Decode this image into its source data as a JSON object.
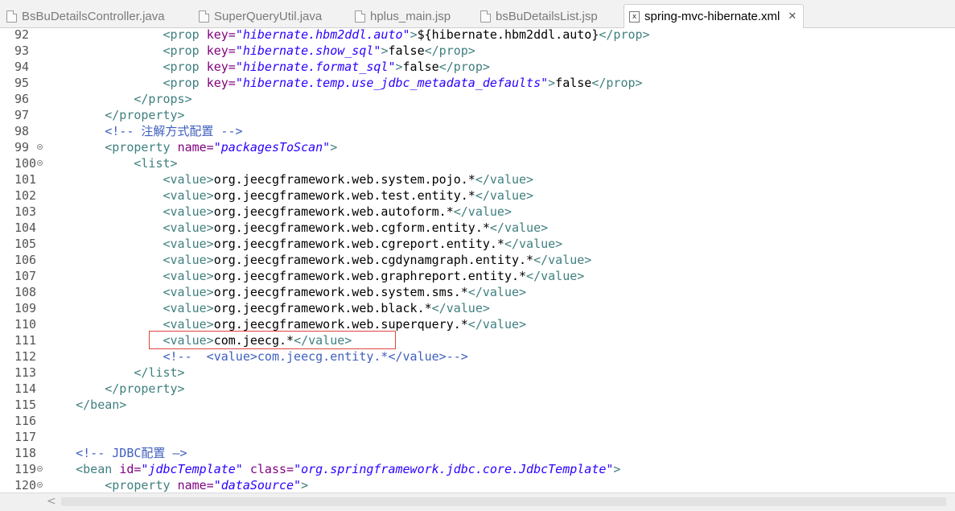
{
  "tabs": [
    {
      "label": "BsBuDetailsController.java",
      "active": false
    },
    {
      "label": "SuperQueryUtil.java",
      "active": false
    },
    {
      "label": "hplus_main.jsp",
      "active": false
    },
    {
      "label": "bsBuDetailsList.jsp",
      "active": false
    },
    {
      "label": "spring-mvc-hibernate.xml",
      "active": true
    }
  ],
  "active_tab_icon": "xml-file-icon",
  "close_glyph": "✕",
  "colors": {
    "tag": "#3f7f7f",
    "attribute": "#7f007f",
    "attribute_value": "#2a00ff",
    "comment": "#3f5fbf",
    "highlight_box": "#e0443e"
  },
  "lines": [
    {
      "n": "92",
      "fold": false,
      "tokens": [
        [
          "x",
          "                "
        ],
        [
          "t",
          "<prop "
        ],
        [
          "a",
          "key="
        ],
        [
          "v",
          "\"hibernate.hbm2ddl.auto\""
        ],
        [
          "t",
          ">"
        ],
        [
          "x",
          "${hibernate.hbm2ddl.auto}"
        ],
        [
          "t",
          "</prop>"
        ]
      ]
    },
    {
      "n": "93",
      "fold": false,
      "tokens": [
        [
          "x",
          "                "
        ],
        [
          "t",
          "<prop "
        ],
        [
          "a",
          "key="
        ],
        [
          "v",
          "\"hibernate.show_sql\""
        ],
        [
          "t",
          ">"
        ],
        [
          "x",
          "false"
        ],
        [
          "t",
          "</prop>"
        ]
      ]
    },
    {
      "n": "94",
      "fold": false,
      "tokens": [
        [
          "x",
          "                "
        ],
        [
          "t",
          "<prop "
        ],
        [
          "a",
          "key="
        ],
        [
          "v",
          "\"hibernate.format_sql\""
        ],
        [
          "t",
          ">"
        ],
        [
          "x",
          "false"
        ],
        [
          "t",
          "</prop>"
        ]
      ]
    },
    {
      "n": "95",
      "fold": false,
      "tokens": [
        [
          "x",
          "                "
        ],
        [
          "t",
          "<prop "
        ],
        [
          "a",
          "key="
        ],
        [
          "v",
          "\"hibernate.temp.use_jdbc_metadata_defaults\""
        ],
        [
          "t",
          ">"
        ],
        [
          "x",
          "false"
        ],
        [
          "t",
          "</prop>"
        ]
      ]
    },
    {
      "n": "96",
      "fold": false,
      "tokens": [
        [
          "x",
          "            "
        ],
        [
          "t",
          "</props>"
        ]
      ]
    },
    {
      "n": "97",
      "fold": false,
      "tokens": [
        [
          "x",
          "        "
        ],
        [
          "t",
          "</property>"
        ]
      ]
    },
    {
      "n": "98",
      "fold": false,
      "tokens": [
        [
          "x",
          "        "
        ],
        [
          "c",
          "<!-- 注解方式配置 -->"
        ]
      ]
    },
    {
      "n": "99",
      "fold": true,
      "tokens": [
        [
          "x",
          "        "
        ],
        [
          "t",
          "<property "
        ],
        [
          "a",
          "name="
        ],
        [
          "v",
          "\"packagesToScan\""
        ],
        [
          "t",
          ">"
        ]
      ]
    },
    {
      "n": "100",
      "fold": true,
      "tokens": [
        [
          "x",
          "            "
        ],
        [
          "t",
          "<list>"
        ]
      ]
    },
    {
      "n": "101",
      "fold": false,
      "tokens": [
        [
          "x",
          "                "
        ],
        [
          "t",
          "<value>"
        ],
        [
          "x",
          "org.jeecgframework.web.system.pojo.*"
        ],
        [
          "t",
          "</value>"
        ]
      ]
    },
    {
      "n": "102",
      "fold": false,
      "tokens": [
        [
          "x",
          "                "
        ],
        [
          "t",
          "<value>"
        ],
        [
          "x",
          "org.jeecgframework.web.test.entity.*"
        ],
        [
          "t",
          "</value>"
        ]
      ]
    },
    {
      "n": "103",
      "fold": false,
      "tokens": [
        [
          "x",
          "                "
        ],
        [
          "t",
          "<value>"
        ],
        [
          "x",
          "org.jeecgframework.web.autoform.*"
        ],
        [
          "t",
          "</value>"
        ]
      ]
    },
    {
      "n": "104",
      "fold": false,
      "tokens": [
        [
          "x",
          "                "
        ],
        [
          "t",
          "<value>"
        ],
        [
          "x",
          "org.jeecgframework.web.cgform.entity.*"
        ],
        [
          "t",
          "</value>"
        ]
      ]
    },
    {
      "n": "105",
      "fold": false,
      "tokens": [
        [
          "x",
          "                "
        ],
        [
          "t",
          "<value>"
        ],
        [
          "x",
          "org.jeecgframework.web.cgreport.entity.*"
        ],
        [
          "t",
          "</value>"
        ]
      ]
    },
    {
      "n": "106",
      "fold": false,
      "tokens": [
        [
          "x",
          "                "
        ],
        [
          "t",
          "<value>"
        ],
        [
          "x",
          "org.jeecgframework.web.cgdynamgraph.entity.*"
        ],
        [
          "t",
          "</value>"
        ]
      ]
    },
    {
      "n": "107",
      "fold": false,
      "tokens": [
        [
          "x",
          "                "
        ],
        [
          "t",
          "<value>"
        ],
        [
          "x",
          "org.jeecgframework.web.graphreport.entity.*"
        ],
        [
          "t",
          "</value>"
        ]
      ]
    },
    {
      "n": "108",
      "fold": false,
      "tokens": [
        [
          "x",
          "                "
        ],
        [
          "t",
          "<value>"
        ],
        [
          "x",
          "org.jeecgframework.web.system.sms.*"
        ],
        [
          "t",
          "</value>"
        ]
      ]
    },
    {
      "n": "109",
      "fold": false,
      "tokens": [
        [
          "x",
          "                "
        ],
        [
          "t",
          "<value>"
        ],
        [
          "x",
          "org.jeecgframework.web.black.*"
        ],
        [
          "t",
          "</value>"
        ]
      ]
    },
    {
      "n": "110",
      "fold": false,
      "tokens": [
        [
          "x",
          "                "
        ],
        [
          "t",
          "<value>"
        ],
        [
          "x",
          "org.jeecgframework.web.superquery.*"
        ],
        [
          "t",
          "</value>"
        ]
      ]
    },
    {
      "n": "111",
      "fold": false,
      "tokens": [
        [
          "x",
          "                "
        ],
        [
          "t",
          "<value>"
        ],
        [
          "x",
          "com.jeecg.*"
        ],
        [
          "t",
          "</value>"
        ]
      ]
    },
    {
      "n": "112",
      "fold": false,
      "tokens": [
        [
          "x",
          "                "
        ],
        [
          "c",
          "<!--  <value>com.jeecg.entity.*</value>-->"
        ]
      ]
    },
    {
      "n": "113",
      "fold": false,
      "tokens": [
        [
          "x",
          "            "
        ],
        [
          "t",
          "</list>"
        ]
      ]
    },
    {
      "n": "114",
      "fold": false,
      "tokens": [
        [
          "x",
          "        "
        ],
        [
          "t",
          "</property>"
        ]
      ]
    },
    {
      "n": "115",
      "fold": false,
      "tokens": [
        [
          "x",
          "    "
        ],
        [
          "t",
          "</bean>"
        ]
      ]
    },
    {
      "n": "116",
      "fold": false,
      "tokens": []
    },
    {
      "n": "117",
      "fold": false,
      "tokens": []
    },
    {
      "n": "118",
      "fold": false,
      "tokens": [
        [
          "x",
          "    "
        ],
        [
          "c",
          "<!-- JDBC配置 —>"
        ]
      ]
    },
    {
      "n": "119",
      "fold": true,
      "tokens": [
        [
          "x",
          "    "
        ],
        [
          "t",
          "<bean "
        ],
        [
          "a",
          "id="
        ],
        [
          "v",
          "\"jdbcTemplate\""
        ],
        [
          "x",
          " "
        ],
        [
          "a",
          "class="
        ],
        [
          "v",
          "\"org.springframework.jdbc.core.JdbcTemplate\""
        ],
        [
          "t",
          ">"
        ]
      ]
    },
    {
      "n": "120",
      "fold": true,
      "tokens": [
        [
          "x",
          "        "
        ],
        [
          "t",
          "<property "
        ],
        [
          "a",
          "name="
        ],
        [
          "v",
          "\"dataSource\""
        ],
        [
          "t",
          ">"
        ]
      ]
    }
  ]
}
